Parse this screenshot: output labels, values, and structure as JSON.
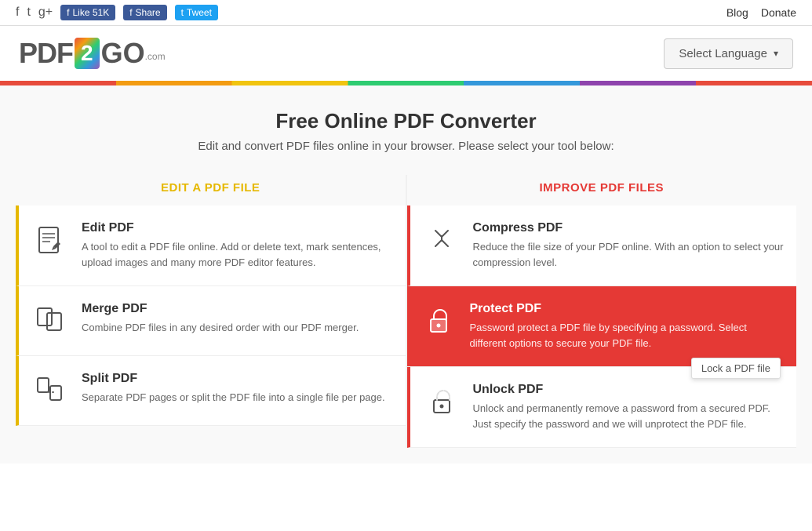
{
  "topbar": {
    "social_icons": [
      "f",
      "twitter",
      "g+"
    ],
    "like_label": "Like 51K",
    "share_label": "Share",
    "tweet_label": "Tweet",
    "blog_label": "Blog",
    "donate_label": "Donate"
  },
  "header": {
    "logo_pdf": "PDF",
    "logo_num": "2",
    "logo_go": "GO",
    "logo_com": ".com",
    "select_language": "Select Language"
  },
  "hero": {
    "title": "Free Online PDF Converter",
    "subtitle": "Edit and convert PDF files online in your browser. Please select your tool below:"
  },
  "left_col": {
    "header": "EDIT A PDF FILE",
    "tools": [
      {
        "id": "edit-pdf",
        "title": "Edit PDF",
        "desc": "A tool to edit a PDF file online. Add or delete text, mark sentences, upload images and many more PDF editor features."
      },
      {
        "id": "merge-pdf",
        "title": "Merge PDF",
        "desc": "Combine PDF files in any desired order with our PDF merger."
      },
      {
        "id": "split-pdf",
        "title": "Split PDF",
        "desc": "Separate PDF pages or split the PDF file into a single file per page."
      }
    ]
  },
  "right_col": {
    "header": "IMPROVE PDF FILES",
    "tools": [
      {
        "id": "compress-pdf",
        "title": "Compress PDF",
        "desc": "Reduce the file size of your PDF online. With an option to select your compression level.",
        "highlighted": false
      },
      {
        "id": "protect-pdf",
        "title": "Protect PDF",
        "desc": "Password protect a PDF file by specifying a password. Select different options to secure your PDF file.",
        "highlighted": true,
        "tooltip": "Lock a PDF file"
      },
      {
        "id": "unlock-pdf",
        "title": "Unlock PDF",
        "desc": "Unlock and permanently remove a password from a secured PDF. Just specify the password and we will unprotect the PDF file.",
        "highlighted": false
      }
    ]
  }
}
